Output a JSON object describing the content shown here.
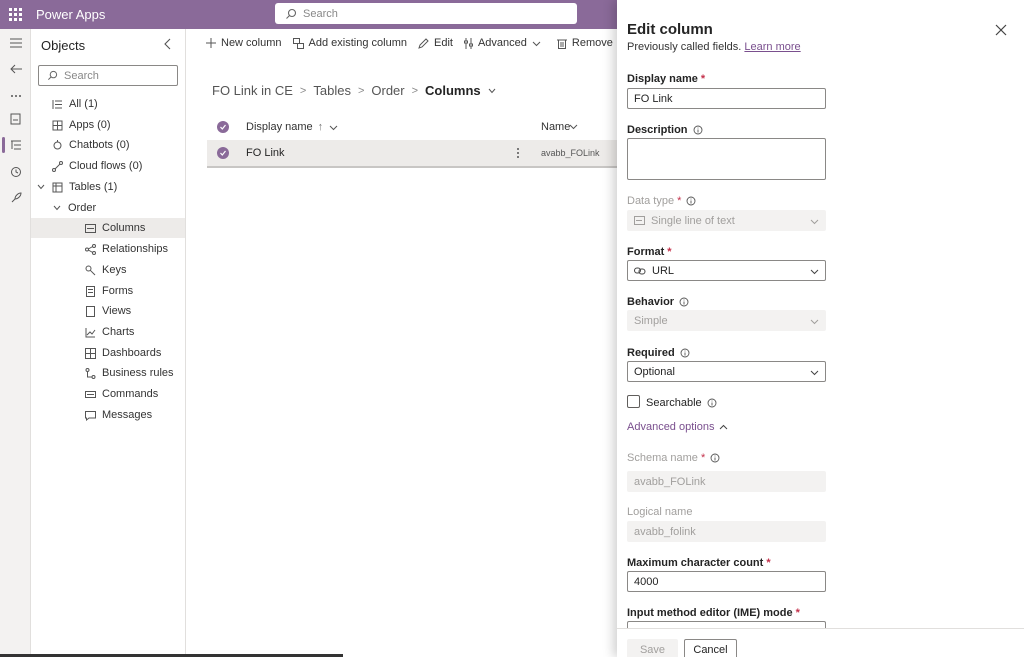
{
  "topbar": {
    "app_title": "Power Apps",
    "search_placeholder": "Search"
  },
  "objects_panel": {
    "title": "Objects",
    "search_placeholder": "Search",
    "items": [
      {
        "label": "All  (1)",
        "icon": "list-icon"
      },
      {
        "label": "Apps  (0)",
        "icon": "apps-icon"
      },
      {
        "label": "Chatbots  (0)",
        "icon": "chatbot-icon"
      },
      {
        "label": "Cloud flows  (0)",
        "icon": "flow-icon"
      },
      {
        "label": "Tables  (1)",
        "icon": "table-icon"
      },
      {
        "label": "Order",
        "icon": ""
      },
      {
        "label": "Columns",
        "icon": "columns-icon"
      },
      {
        "label": "Relationships",
        "icon": "relationships-icon"
      },
      {
        "label": "Keys",
        "icon": "key-icon"
      },
      {
        "label": "Forms",
        "icon": "form-icon"
      },
      {
        "label": "Views",
        "icon": "view-icon"
      },
      {
        "label": "Charts",
        "icon": "chart-icon"
      },
      {
        "label": "Dashboards",
        "icon": "dashboard-icon"
      },
      {
        "label": "Business rules",
        "icon": "business-rules-icon"
      },
      {
        "label": "Commands",
        "icon": "commands-icon"
      },
      {
        "label": "Messages",
        "icon": "message-icon"
      }
    ]
  },
  "commandbar": {
    "new_column": "New column",
    "add_existing_column": "Add existing column",
    "edit": "Edit",
    "advanced": "Advanced",
    "remove": "Remove"
  },
  "breadcrumb": {
    "solution": "FO Link in CE",
    "tables": "Tables",
    "table": "Order",
    "current": "Columns"
  },
  "grid": {
    "col_display_name": "Display name",
    "col_name": "Name",
    "sort_indicator": "↑",
    "rows": [
      {
        "display_name": "FO Link",
        "name": "avabb_FOLink"
      }
    ]
  },
  "edit_panel": {
    "title": "Edit column",
    "subtitle": "Previously called fields.",
    "learn_more": "Learn more",
    "display_name_label": "Display name",
    "display_name_value": "FO Link",
    "description_label": "Description",
    "data_type_label": "Data type",
    "data_type_value": "Single line of text",
    "format_label": "Format",
    "format_value": "URL",
    "behavior_label": "Behavior",
    "behavior_value": "Simple",
    "required_label": "Required",
    "required_value": "Optional",
    "searchable_label": "Searchable",
    "advanced_options": "Advanced options",
    "schema_name_label": "Schema name",
    "schema_name_value": "avabb_FOLink",
    "logical_name_label": "Logical name",
    "logical_name_value": "avabb_folink",
    "max_char_label": "Maximum character count",
    "max_char_value": "4000",
    "ime_label": "Input method editor (IME) mode",
    "required_marker": "*",
    "save": "Save",
    "cancel": "Cancel"
  },
  "colors": {
    "brand": "#8a6a99",
    "link": "#7a4f8e",
    "required": "#c4314b"
  }
}
